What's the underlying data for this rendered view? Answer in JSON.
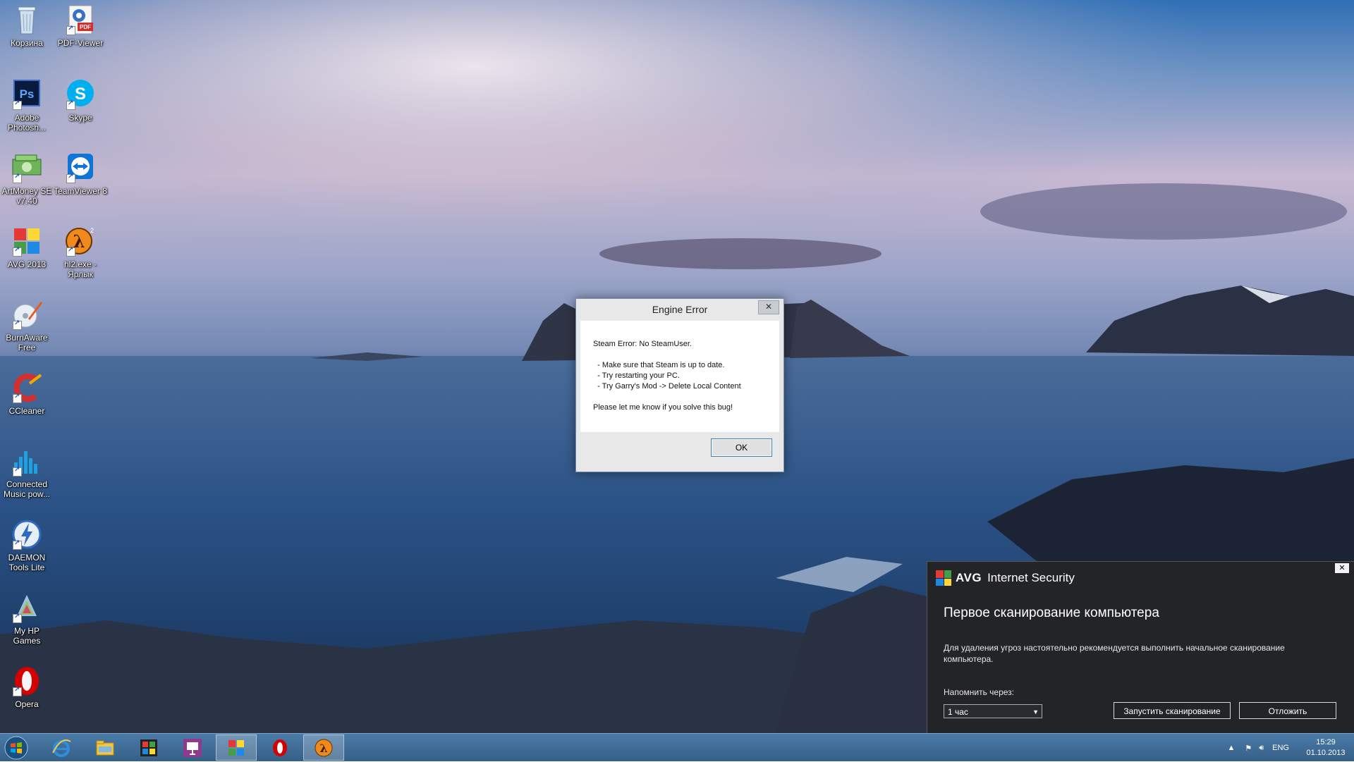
{
  "desktop": {
    "icons": [
      {
        "label": "Корзина",
        "icon": "recycle-bin-icon"
      },
      {
        "label": "PDF-Viewer",
        "icon": "pdf-viewer-icon"
      },
      {
        "label": "Adobe Photosh...",
        "icon": "photoshop-icon"
      },
      {
        "label": "Skype",
        "icon": "skype-icon"
      },
      {
        "label": "ArtMoney SE v7.40",
        "icon": "artmoney-icon"
      },
      {
        "label": "TeamViewer 8",
        "icon": "teamviewer-icon"
      },
      {
        "label": "AVG 2013",
        "icon": "avg-icon"
      },
      {
        "label": "hl2.exe - Ярлык",
        "icon": "half-life-icon"
      },
      {
        "label": "BurnAware Free",
        "icon": "burnaware-icon"
      },
      {
        "label": "CCleaner",
        "icon": "ccleaner-icon"
      },
      {
        "label": "Connected Music pow...",
        "icon": "connected-music-icon"
      },
      {
        "label": "DAEMON Tools Lite",
        "icon": "daemon-tools-icon"
      },
      {
        "label": "My HP Games",
        "icon": "hp-games-icon"
      },
      {
        "label": "Opera",
        "icon": "opera-icon"
      }
    ]
  },
  "dialog": {
    "title": "Engine Error",
    "close": "✕",
    "message": "Steam Error: No SteamUser.\n\n  - Make sure that Steam is up to date.\n  - Try restarting your PC.\n  - Try Garry's Mod -> Delete Local Content\n\nPlease let me know if you solve this bug!",
    "ok_label": "OK"
  },
  "avg_popup": {
    "close": "✕",
    "brand": "AVG",
    "product": "Internet Security",
    "heading": "Первое сканирование компьютера",
    "description": "Для удаления угроз настоятельно рекомендуется выполнить начальное сканирование компьютера.",
    "remind_label": "Напомнить через:",
    "remind_value": "1 час",
    "scan_button": "Запустить сканирование",
    "postpone_button": "Отложить",
    "logo_colors": [
      "#e53935",
      "#43a047",
      "#1e88e5",
      "#fdd835"
    ]
  },
  "taskbar": {
    "pinned": [
      {
        "icon": "internet-explorer-icon"
      },
      {
        "icon": "file-explorer-icon"
      },
      {
        "icon": "media-center-icon"
      },
      {
        "icon": "presentation-icon"
      },
      {
        "icon": "avg-icon"
      },
      {
        "icon": "opera-icon"
      },
      {
        "icon": "half-life-icon"
      }
    ],
    "language": "ENG",
    "time": "15:29",
    "date": "01.10.2013"
  }
}
